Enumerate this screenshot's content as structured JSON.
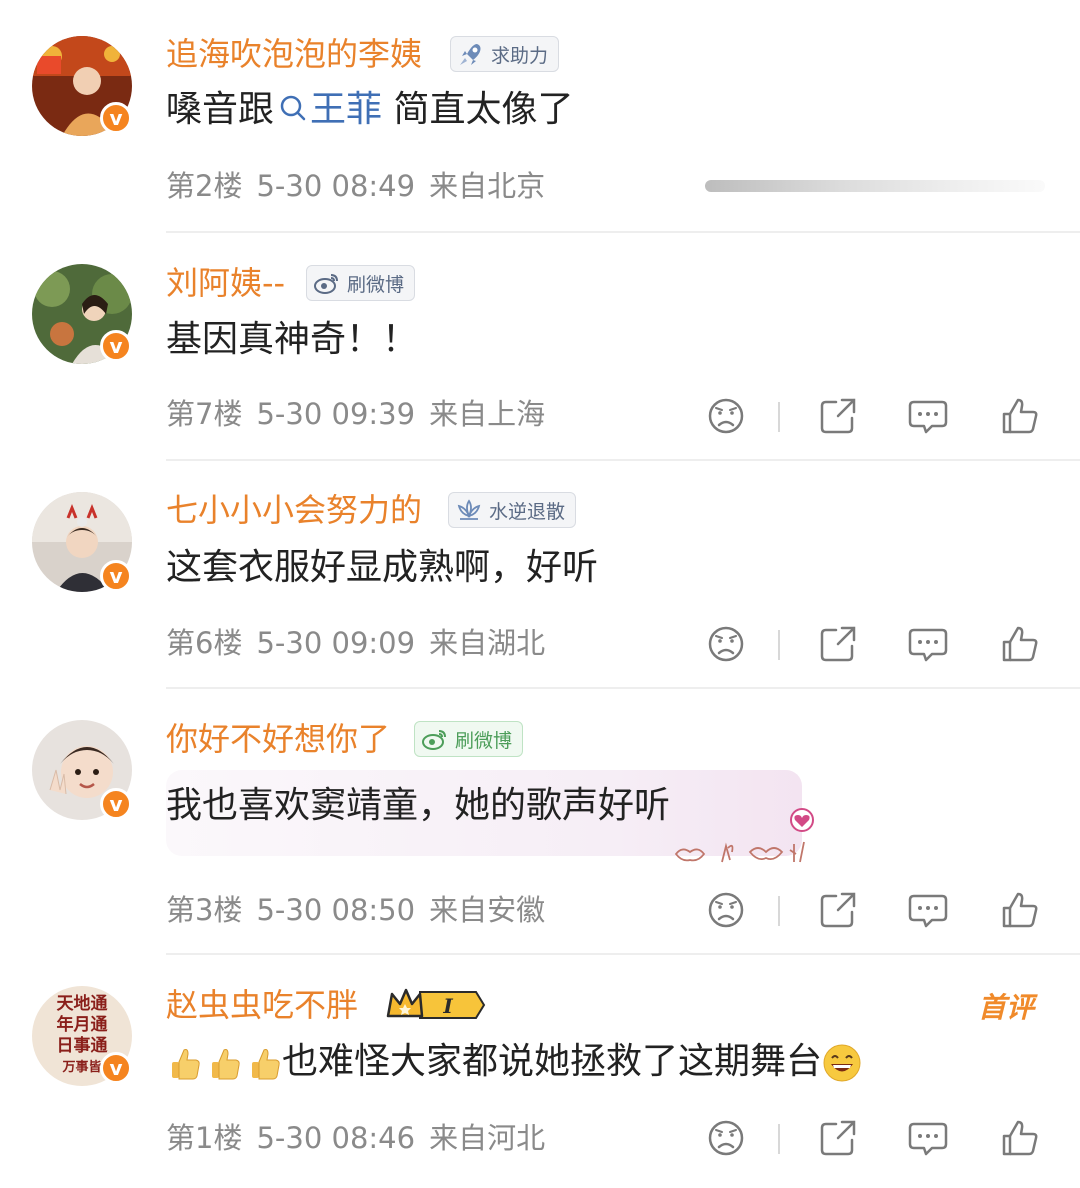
{
  "comments": [
    {
      "username": "追海吹泡泡的李姨",
      "badge": "求助力",
      "text_before": "嗓音跟",
      "link_text": "王菲",
      "text_after": " 简直太像了",
      "floor": "第2楼",
      "date": "5-30 08:49",
      "location": "来自北京"
    },
    {
      "username": "刘阿姨--",
      "badge": "刷微博",
      "text": "基因真神奇！！",
      "floor": "第7楼",
      "date": "5-30 09:39",
      "location": "来自上海"
    },
    {
      "username": "七小小小会努力的",
      "badge": "水逆退散",
      "text": "这套衣服好显成熟啊，好听",
      "floor": "第6楼",
      "date": "5-30 09:09",
      "location": "来自湖北"
    },
    {
      "username": "你好不好想你了",
      "badge": "刷微博",
      "text": "我也喜欢窦靖童，她的歌声好听",
      "floor": "第3楼",
      "date": "5-30 08:50",
      "location": "来自安徽"
    },
    {
      "username": "赵虫虫吃不胖",
      "level": "I",
      "text": "也难怪大家都说她拯救了这期舞台",
      "floor": "第1楼",
      "date": "5-30 08:46",
      "location": "来自河北",
      "first_comment_label": "首评"
    }
  ],
  "avatar4_text": [
    "天地通",
    "年月通",
    "日事通",
    "万事皆"
  ],
  "colors": {
    "username": "#e9822b",
    "link": "#3f6fb5",
    "meta": "#8a8a8a",
    "verified": "#f5841f"
  },
  "icons": [
    "search-icon",
    "dislike-icon",
    "share-icon",
    "comment-icon",
    "like-icon",
    "verified-icon",
    "crown-icon",
    "thumbs-up-emoji",
    "grin-emoji"
  ]
}
